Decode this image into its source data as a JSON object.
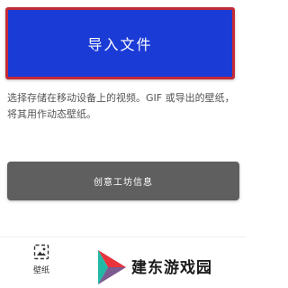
{
  "import_button": {
    "label": "导入文件"
  },
  "description": {
    "text": "选择存储在移动设备上的视频。GIF 或导出的壁纸，将其用作动态壁纸。"
  },
  "workshop_button": {
    "label": "创意工坊信息"
  },
  "bottom_nav": {
    "wallpaper": {
      "label": "壁纸",
      "icon": "wallpaper-icon"
    }
  },
  "watermark": {
    "text": "建东游戏园",
    "logo": "jiandong-logo-icon"
  },
  "colors": {
    "import_button_bg": "#1b3bd6",
    "import_button_border": "#c22b36",
    "workshop_button_bg": "#5f5f5f",
    "description_text": "#555555"
  }
}
